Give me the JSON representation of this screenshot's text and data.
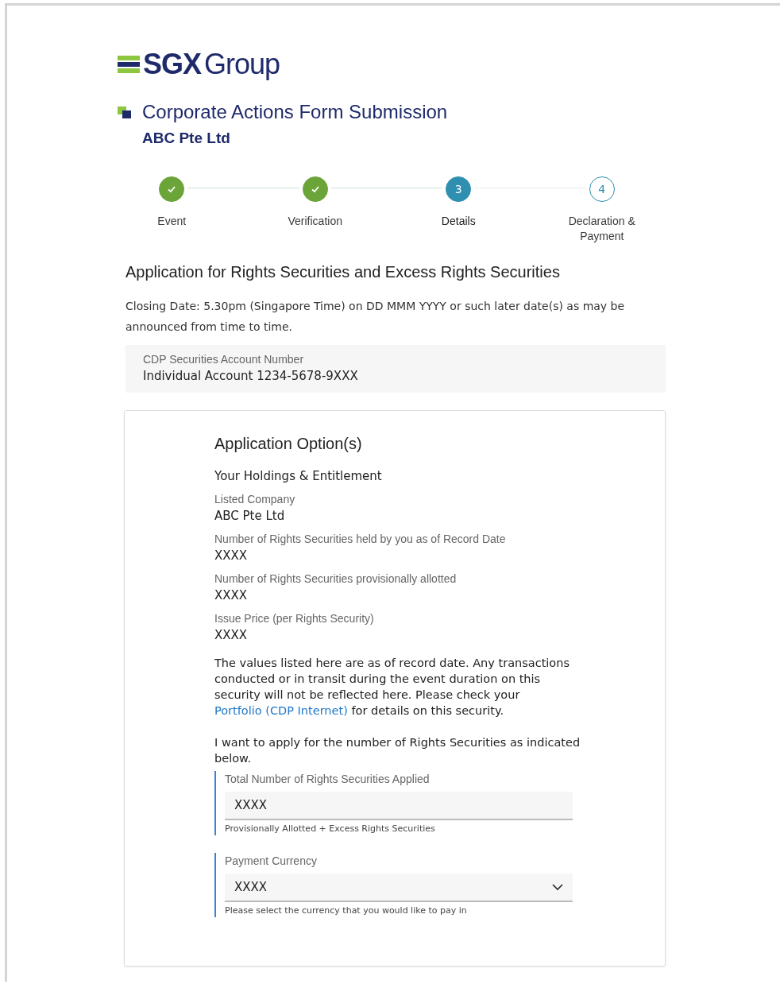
{
  "logo": {
    "strong": "SGX",
    "light": "Group"
  },
  "header": {
    "title": "Corporate Actions Form Submission",
    "company": "ABC Pte Ltd"
  },
  "steps": [
    {
      "label": "Event",
      "completed": true,
      "selected": false
    },
    {
      "label": "Verification",
      "completed": true,
      "selected": false
    },
    {
      "label": "Details",
      "number": "3",
      "completed": false,
      "selected": true
    },
    {
      "label": "Declaration & Payment",
      "number": "4",
      "completed": false,
      "selected": false
    }
  ],
  "form_title": "Application for Rights Securities and Excess Rights Securities",
  "closing_note": "Closing Date: 5.30pm (Singapore Time) on DD MMM YYYY or such later date(s) as may be announced from time to time.",
  "account": {
    "label": "CDP Securities Account Number",
    "value": "Individual Account 1234-5678-9XXX"
  },
  "card": {
    "title": "Application Option(s)",
    "subtitle": "Your Holdings & Entitlement",
    "fields": [
      {
        "label": "Listed Company",
        "value": "ABC Pte Ltd"
      },
      {
        "label": "Number of Rights Securities held by you as of Record Date",
        "value": "XXXX"
      },
      {
        "label": "Number of Rights Securities provisionally allotted",
        "value": "XXXX"
      },
      {
        "label": "Issue Price (per Rights Security)",
        "value": "XXXX"
      }
    ],
    "notice": {
      "before": "The values listed here are as of record date. Any transactions conducted or in transit during the event duration on this security will not be reflected here. Please check your ",
      "link": "Portfolio (CDP Internet)",
      "after": " for details on this security."
    },
    "instruction": "I want to apply for the number of Rights Securities as indicated below.",
    "inputs": [
      {
        "kind": "text",
        "label": "Total Number of Rights Securities Applied",
        "value": "XXXX",
        "hint": "Provisionally Allotted + Excess Rights Securities"
      },
      {
        "kind": "select",
        "label": "Payment Currency",
        "value": "XXXX",
        "hint": "Please select the currency that you would like to pay in"
      }
    ]
  }
}
